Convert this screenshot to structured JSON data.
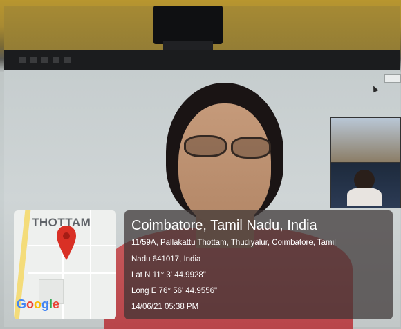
{
  "overlay": {
    "map_label": "THOTTAM",
    "map_attribution": "Google",
    "location": "Coimbatore, Tamil Nadu, India",
    "address_line1": "11/59A, Pallakattu Thottam, Thudiyalur, Coimbatore, Tamil",
    "address_line2": "Nadu 641017, India",
    "latitude": "Lat N 11° 3' 44.9928\"",
    "longitude": "Long E 76° 56' 44.9556\"",
    "timestamp": "14/06/21 05:38 PM"
  },
  "icons": [
    "map-pin-icon",
    "cursor-icon",
    "webcam-icon"
  ],
  "colors": {
    "pin": "#d93025",
    "card": "#3c3434"
  }
}
